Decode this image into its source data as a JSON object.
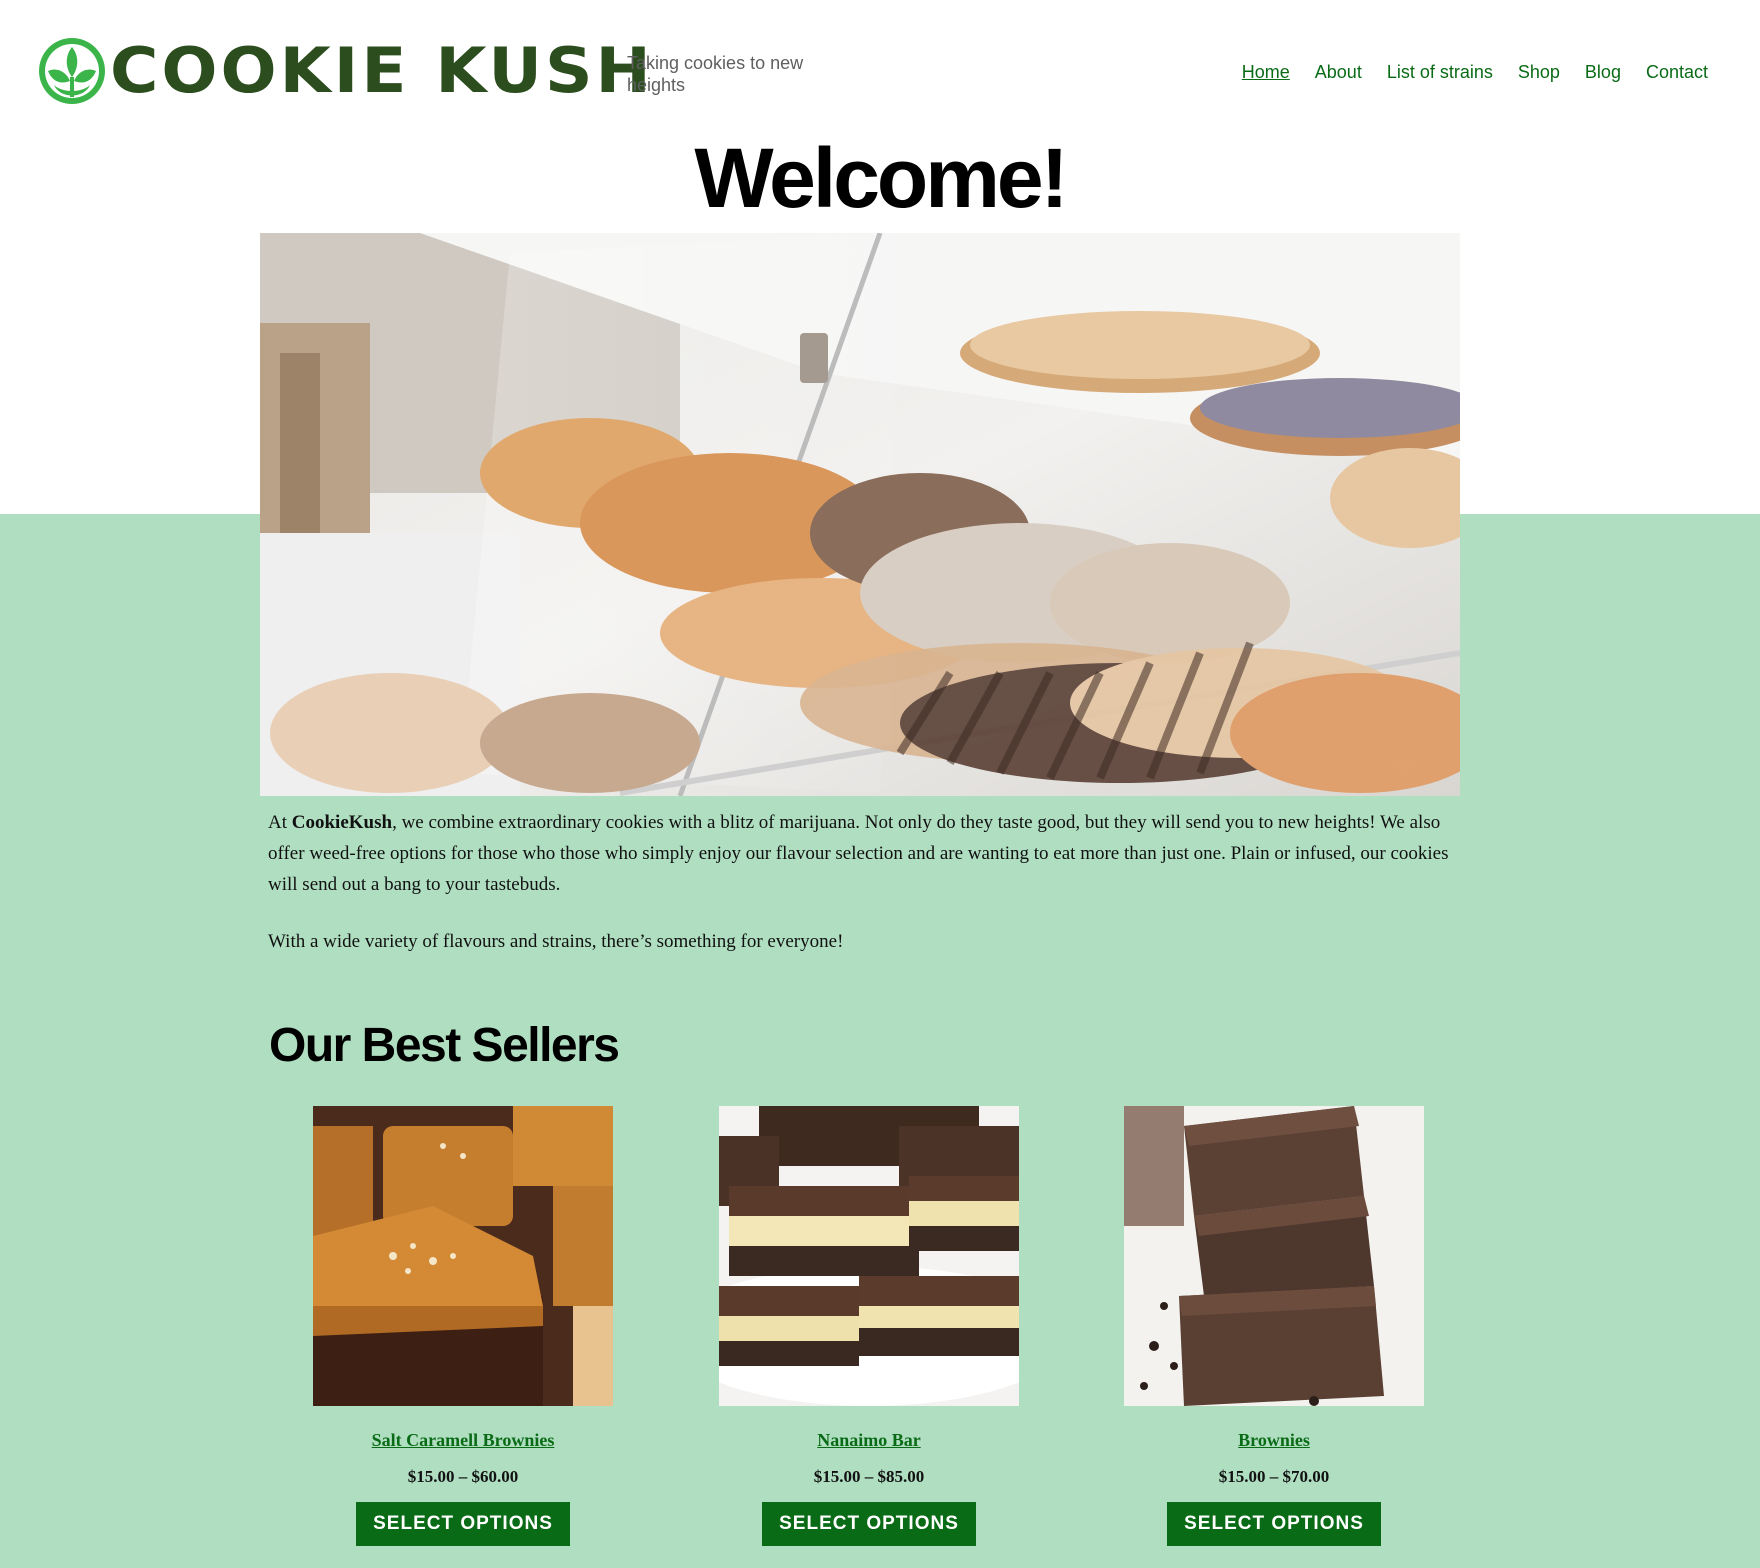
{
  "header": {
    "logo_text": "COOKIE KUSH",
    "tagline": "Taking cookies to new heights",
    "nav": [
      {
        "label": "Home",
        "active": true
      },
      {
        "label": "About"
      },
      {
        "label": "List of strains"
      },
      {
        "label": "Shop"
      },
      {
        "label": "Blog"
      },
      {
        "label": "Contact"
      }
    ]
  },
  "hero": {
    "heading": "Welcome!",
    "image": "bakery-display-case-with-cookies"
  },
  "intro": {
    "p1_prefix": "At ",
    "p1_brand": "CookieKush",
    "p1_rest": ", we combine extraordinary cookies with a blitz of marijuana. Not only do they taste good, but they will send you to new heights! We also offer weed-free options for those who those who simply enjoy our flavour selection and are wanting to eat more than just one. Plain or infused, our cookies will send out a bang to your tastebuds.",
    "p2": "With a wide variety of flavours and strains, there’s something for everyone!"
  },
  "best_sellers": {
    "title": "Our Best Sellers",
    "products": [
      {
        "name": "Salt Caramell Brownies",
        "price": "$15.00 – $60.00",
        "button": "SELECT OPTIONS",
        "image": "salt-caramel-brownies"
      },
      {
        "name": "Nanaimo Bar",
        "price": "$15.00 – $85.00",
        "button": "SELECT OPTIONS",
        "image": "nanaimo-bars"
      },
      {
        "name": "Brownies",
        "price": "$15.00 – $70.00",
        "button": "SELECT OPTIONS",
        "image": "stacked-brownies"
      }
    ]
  },
  "colors": {
    "brand_green": "#0a6b16",
    "logo_dark_green": "#2c4d1e",
    "logo_icon_green": "#3bb54a",
    "band_mint": "#afdec1"
  }
}
